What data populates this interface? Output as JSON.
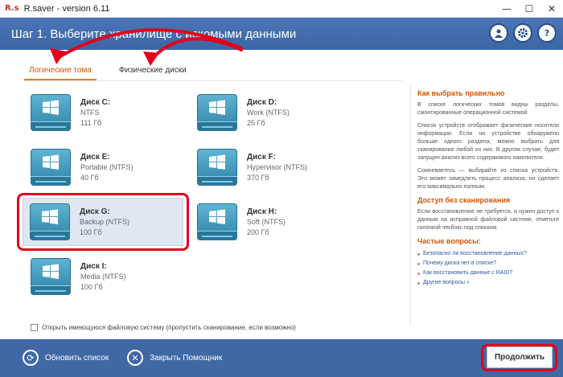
{
  "window": {
    "logo": "R.s",
    "title": "R.saver - version 6.11",
    "controls": [
      "—",
      "☐",
      "✕"
    ]
  },
  "header": {
    "title": "Шаг 1. Выберите хранилище с искомыми данными",
    "icons": [
      "user-icon",
      "gear-icon",
      "help-icon"
    ]
  },
  "tabs": [
    {
      "label": "Логические тома",
      "active": true
    },
    {
      "label": "Физические диски",
      "active": false
    }
  ],
  "disks": [
    {
      "name": "Диск C:",
      "fs": "NTFS",
      "size": "111 Гб"
    },
    {
      "name": "Диск D:",
      "fs": "Work (NTFS)",
      "size": "25 Гб"
    },
    {
      "name": "Диск E:",
      "fs": "Portable (NTFS)",
      "size": "40 Гб"
    },
    {
      "name": "Диск F:",
      "fs": "Hypervisor (NTFS)",
      "size": "370 Гб"
    },
    {
      "name": "Диск G:",
      "fs": "Backup (NTFS)",
      "size": "100 Гб",
      "selected": true
    },
    {
      "name": "Диск H:",
      "fs": "Soft (NTFS)",
      "size": "200 Гб"
    },
    {
      "name": "Диск I:",
      "fs": "Media (NTFS)",
      "size": "100 Гб"
    }
  ],
  "checkbox": {
    "label": "Открыть имеющуюся файловую систему (пропустить сканирование, если возможно)",
    "checked": false
  },
  "sidebar": {
    "h1": "Как выбрать правильно",
    "p1": "В списке логических томов видны разделы, смонтированные операционной системой.",
    "p2": "Список устройств отображает физические носители информации. Если на устройстве обнаружено больше одного раздела, можно выбрать для сканирования любой из них. В другом случае, будет запущен анализ всего содержимого накопителя.",
    "p3": "Сомневаетесь — выбирайте из списка устройств. Это может замедлить процесс анализа, но сделает его максимально полным.",
    "h2": "Доступ без сканирования",
    "p4": "Если восстановление не требуется, и нужен доступ к данным на исправной файловой системе, отметьте галочкой чекбокс под списком.",
    "h3": "Частые вопросы:",
    "faq": [
      "Безопасно ли восстановление данных?",
      "Почему диска нет в списке?",
      "Как восстановить данные с RAID?",
      "Другие вопросы »"
    ]
  },
  "footer": {
    "refresh_label": "Обновить список",
    "close_label": "Закрыть Помощник",
    "continue_label": "Продолжить"
  },
  "colors": {
    "header_bg": "#4a75b6",
    "footer_bg": "#3f68a5",
    "accent": "#e67e22",
    "highlight_red": "#e3001b",
    "disk_blue": "#3b95bd"
  }
}
